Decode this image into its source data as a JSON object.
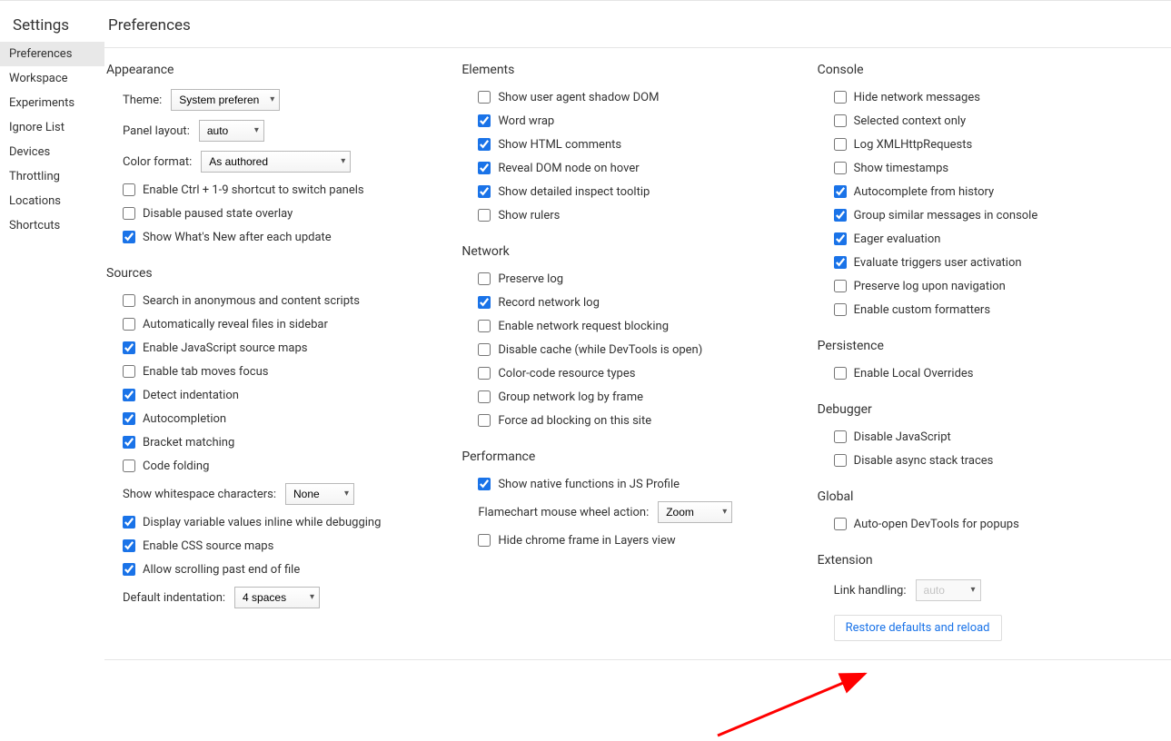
{
  "sidebar": {
    "title": "Settings",
    "items": [
      {
        "label": "Preferences",
        "selected": true
      },
      {
        "label": "Workspace"
      },
      {
        "label": "Experiments"
      },
      {
        "label": "Ignore List"
      },
      {
        "label": "Devices"
      },
      {
        "label": "Throttling"
      },
      {
        "label": "Locations"
      },
      {
        "label": "Shortcuts"
      }
    ]
  },
  "page": {
    "title": "Preferences"
  },
  "appearance": {
    "title": "Appearance",
    "theme_label": "Theme:",
    "theme_value": "System preference",
    "panel_label": "Panel layout:",
    "panel_value": "auto",
    "color_label": "Color format:",
    "color_value": "As authored",
    "chk1": {
      "label": "Enable Ctrl + 1-9 shortcut to switch panels",
      "checked": false
    },
    "chk2": {
      "label": "Disable paused state overlay",
      "checked": false
    },
    "chk3": {
      "label": "Show What's New after each update",
      "checked": true
    }
  },
  "sources": {
    "title": "Sources",
    "chk1": {
      "label": "Search in anonymous and content scripts",
      "checked": false
    },
    "chk2": {
      "label": "Automatically reveal files in sidebar",
      "checked": false
    },
    "chk3": {
      "label": "Enable JavaScript source maps",
      "checked": true
    },
    "chk4": {
      "label": "Enable tab moves focus",
      "checked": false
    },
    "chk5": {
      "label": "Detect indentation",
      "checked": true
    },
    "chk6": {
      "label": "Autocompletion",
      "checked": true
    },
    "chk7": {
      "label": "Bracket matching",
      "checked": true
    },
    "chk8": {
      "label": "Code folding",
      "checked": false
    },
    "ws_label": "Show whitespace characters:",
    "ws_value": "None",
    "chk9": {
      "label": "Display variable values inline while debugging",
      "checked": true
    },
    "chk10": {
      "label": "Enable CSS source maps",
      "checked": true
    },
    "chk11": {
      "label": "Allow scrolling past end of file",
      "checked": true
    },
    "indent_label": "Default indentation:",
    "indent_value": "4 spaces"
  },
  "elements": {
    "title": "Elements",
    "chk1": {
      "label": "Show user agent shadow DOM",
      "checked": false
    },
    "chk2": {
      "label": "Word wrap",
      "checked": true
    },
    "chk3": {
      "label": "Show HTML comments",
      "checked": true
    },
    "chk4": {
      "label": "Reveal DOM node on hover",
      "checked": true
    },
    "chk5": {
      "label": "Show detailed inspect tooltip",
      "checked": true
    },
    "chk6": {
      "label": "Show rulers",
      "checked": false
    }
  },
  "network": {
    "title": "Network",
    "chk1": {
      "label": "Preserve log",
      "checked": false
    },
    "chk2": {
      "label": "Record network log",
      "checked": true
    },
    "chk3": {
      "label": "Enable network request blocking",
      "checked": false
    },
    "chk4": {
      "label": "Disable cache (while DevTools is open)",
      "checked": false
    },
    "chk5": {
      "label": "Color-code resource types",
      "checked": false
    },
    "chk6": {
      "label": "Group network log by frame",
      "checked": false
    },
    "chk7": {
      "label": "Force ad blocking on this site",
      "checked": false
    }
  },
  "performance": {
    "title": "Performance",
    "chk1": {
      "label": "Show native functions in JS Profile",
      "checked": true
    },
    "wheel_label": "Flamechart mouse wheel action:",
    "wheel_value": "Zoom",
    "chk2": {
      "label": "Hide chrome frame in Layers view",
      "checked": false
    }
  },
  "console": {
    "title": "Console",
    "chk1": {
      "label": "Hide network messages",
      "checked": false
    },
    "chk2": {
      "label": "Selected context only",
      "checked": false
    },
    "chk3": {
      "label": "Log XMLHttpRequests",
      "checked": false
    },
    "chk4": {
      "label": "Show timestamps",
      "checked": false
    },
    "chk5": {
      "label": "Autocomplete from history",
      "checked": true
    },
    "chk6": {
      "label": "Group similar messages in console",
      "checked": true
    },
    "chk7": {
      "label": "Eager evaluation",
      "checked": true
    },
    "chk8": {
      "label": "Evaluate triggers user activation",
      "checked": true
    },
    "chk9": {
      "label": "Preserve log upon navigation",
      "checked": false
    },
    "chk10": {
      "label": "Enable custom formatters",
      "checked": false
    }
  },
  "persistence": {
    "title": "Persistence",
    "chk1": {
      "label": "Enable Local Overrides",
      "checked": false
    }
  },
  "debugger": {
    "title": "Debugger",
    "chk1": {
      "label": "Disable JavaScript",
      "checked": false
    },
    "chk2": {
      "label": "Disable async stack traces",
      "checked": false
    }
  },
  "global": {
    "title": "Global",
    "chk1": {
      "label": "Auto-open DevTools for popups",
      "checked": false
    }
  },
  "extension": {
    "title": "Extension",
    "link_label": "Link handling:",
    "link_value": "auto"
  },
  "restore_label": "Restore defaults and reload"
}
